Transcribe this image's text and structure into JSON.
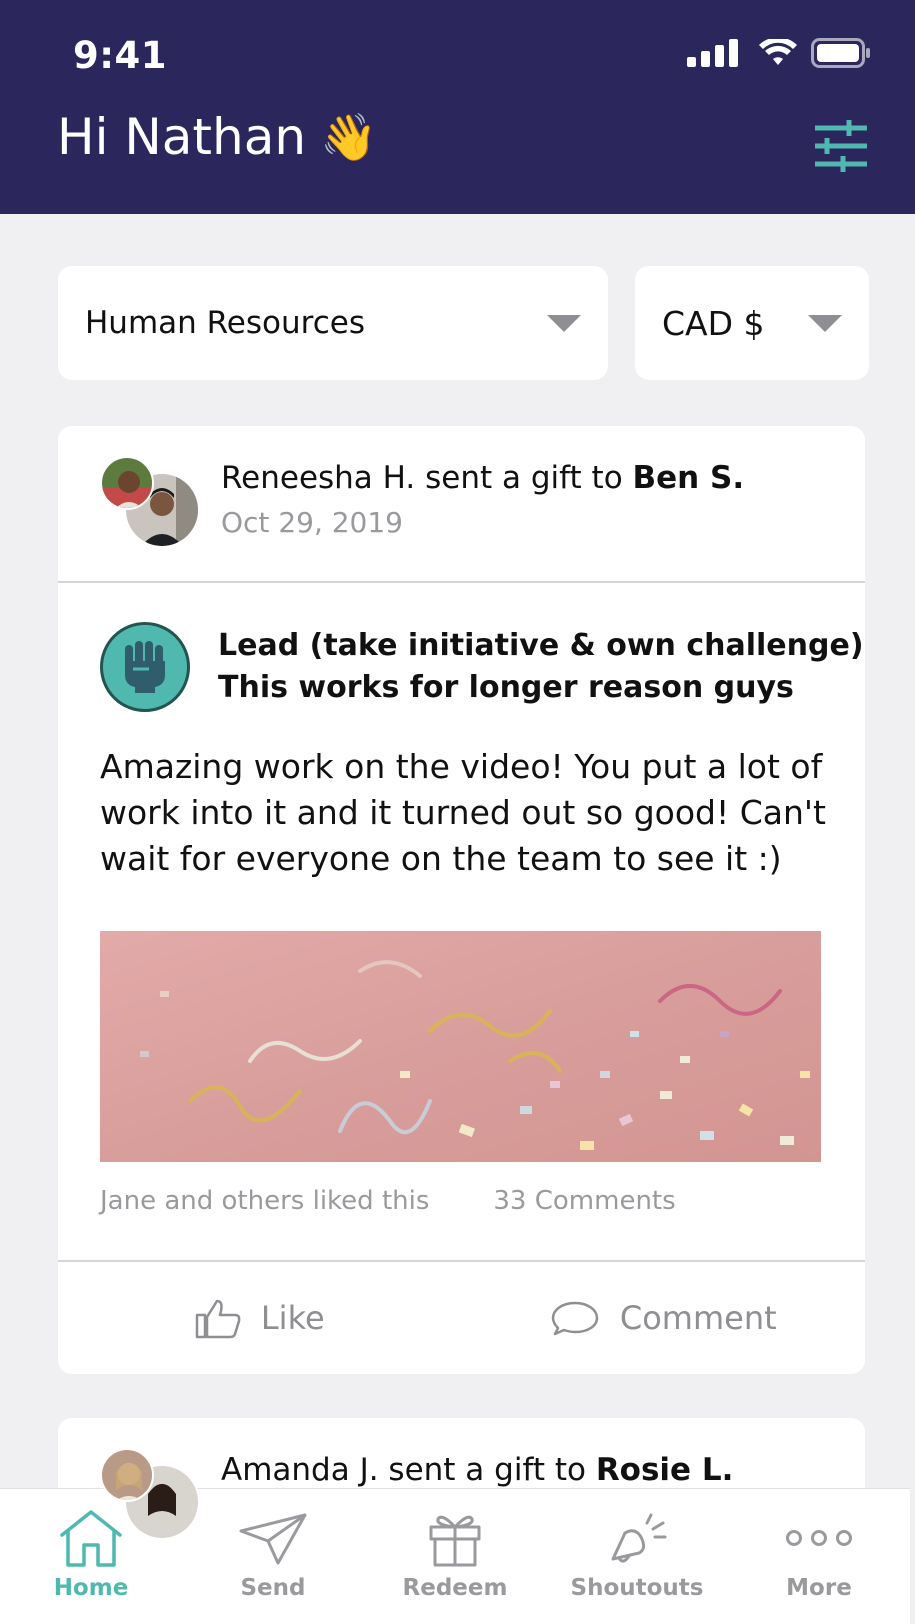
{
  "status_bar": {
    "time": "9:41"
  },
  "header": {
    "greeting": "Hi Nathan",
    "wave_emoji": "👋",
    "filter_icon": "sliders-icon"
  },
  "filters": {
    "department": "Human Resources",
    "currency": "CAD $"
  },
  "feed": [
    {
      "sender": "Reneesha H.",
      "action_text": " sent a gift to ",
      "recipient": "Ben S.",
      "date": "Oct 29, 2019",
      "value_line1": "Lead (take initiative & own challenge)",
      "value_line2": "This works for longer reason guys",
      "value_icon": "raised-fist-icon",
      "message": "Amazing work on the video! You put a lot of work into it and it turned out so good! Can't wait for everyone on the team to see it :)",
      "likes_text": "Jane and others liked this",
      "comments_text": "33 Comments",
      "like_label": "Like",
      "comment_label": "Comment"
    },
    {
      "sender": "Amanda J.",
      "action_text": " sent a gift to ",
      "recipient": "Rosie L."
    }
  ],
  "tabbar": {
    "items": [
      {
        "label": "Home",
        "icon": "home-icon",
        "active": true
      },
      {
        "label": "Send",
        "icon": "paper-plane-icon",
        "active": false
      },
      {
        "label": "Redeem",
        "icon": "gift-icon",
        "active": false
      },
      {
        "label": "Shoutouts",
        "icon": "megaphone-icon",
        "active": false
      },
      {
        "label": "More",
        "icon": "more-dots-icon",
        "active": false
      }
    ]
  },
  "colors": {
    "header_bg": "#2b265c",
    "accent": "#4fb9b0",
    "muted": "#9a9a9e",
    "page_bg": "#f0f0f2"
  }
}
